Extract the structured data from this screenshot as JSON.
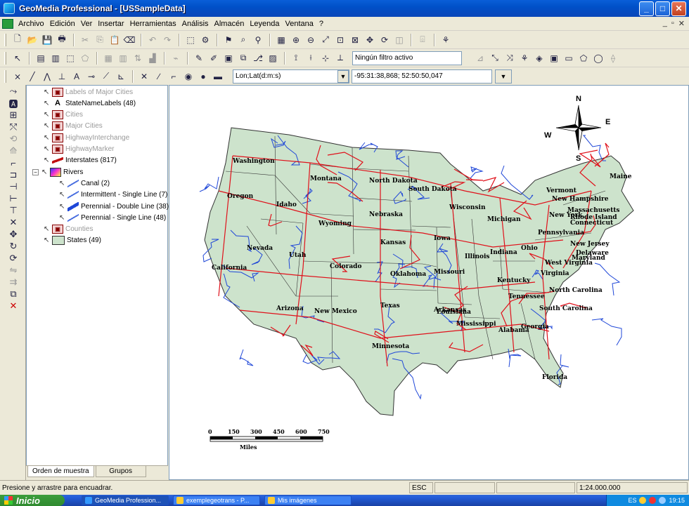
{
  "window": {
    "title": "GeoMedia Professional - [USSampleData]"
  },
  "menu": [
    "Archivo",
    "Edición",
    "Ver",
    "Insertar",
    "Herramientas",
    "Análisis",
    "Almacén",
    "Leyenda",
    "Ventana",
    "?"
  ],
  "toolbar": {
    "filter_value": "Ningún filtro activo",
    "coord_format": "Lon;Lat(d:m:s)",
    "coord_readout": "-95:31:38,868; 52:50:50,047"
  },
  "legend": {
    "entries": [
      {
        "label": "Labels of Major Cities",
        "dim": true
      },
      {
        "label": "StateNameLabels (48)",
        "dim": false
      },
      {
        "label": "Cities",
        "dim": true
      },
      {
        "label": "Major Cities",
        "dim": true
      },
      {
        "label": "HighwayInterchange",
        "dim": true
      },
      {
        "label": "HighwayMarker",
        "dim": true
      },
      {
        "label": "Interstates (817)",
        "dim": false
      },
      {
        "label": "Rivers",
        "dim": false
      },
      {
        "label": "Canal (2)",
        "dim": false
      },
      {
        "label": "Intermittent - Single Line (7)",
        "dim": false
      },
      {
        "label": "Perennial - Double Line (38)",
        "dim": false
      },
      {
        "label": "Perennial - Single Line (48)",
        "dim": false
      },
      {
        "label": "Counties",
        "dim": true
      },
      {
        "label": "States (49)",
        "dim": false
      }
    ],
    "tabs": [
      "Orden de muestra",
      "Grupos"
    ]
  },
  "map": {
    "compass": {
      "n": "N",
      "e": "E",
      "s": "S",
      "w": "W"
    },
    "state_labels": [
      "Washington",
      "Oregon",
      "California",
      "Idaho",
      "Nevada",
      "Montana",
      "Wyoming",
      "Utah",
      "Arizona",
      "Colorado",
      "New Mexico",
      "North Dakota",
      "South Dakota",
      "Nebraska",
      "Kansas",
      "Oklahoma",
      "Texas",
      "Minnesota",
      "Iowa",
      "Missouri",
      "Arkansas",
      "Louisiana",
      "Wisconsin",
      "Illinois",
      "Mississippi",
      "Michigan",
      "Indiana",
      "Kentucky",
      "Tennessee",
      "Alabama",
      "Ohio",
      "Georgia",
      "Florida",
      "West Virginia",
      "Virginia",
      "North Carolina",
      "South Carolina",
      "Pennsylvania",
      "New York",
      "Vermont",
      "New Hampshire",
      "Maine",
      "Massachusetts",
      "Rhode Island",
      "Connecticut",
      "New Jersey",
      "Delaware",
      "Maryland"
    ],
    "scale_ticks": [
      "0",
      "150",
      "300",
      "450",
      "600",
      "750"
    ],
    "scale_unit": "Miles",
    "colors": {
      "land": "#cde3cc",
      "rivers": "#1f47d8",
      "highways": "#e0101a",
      "borders": "#333333"
    }
  },
  "status": {
    "message": "Presione y arrastre para encuadrar.",
    "key": "ESC",
    "scale": "1:24.000.000"
  },
  "taskbar": {
    "start": "Inicio",
    "tasks": [
      "GeoMedia Profession...",
      "exemplegeotrans - P...",
      "Mis imágenes"
    ],
    "lang": "ES",
    "clock": "19:15"
  }
}
